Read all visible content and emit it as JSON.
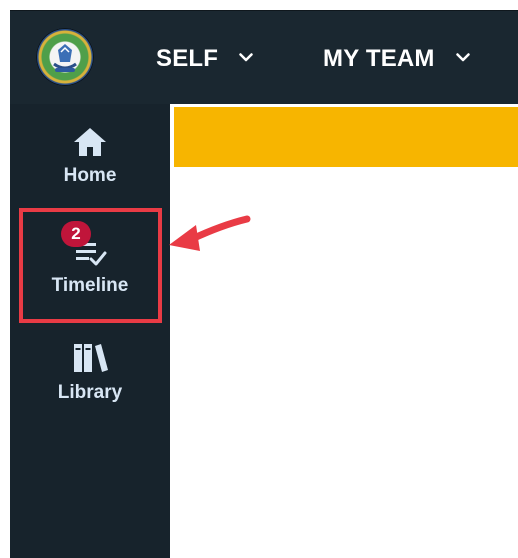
{
  "topnav": {
    "items": [
      {
        "label": "SELF"
      },
      {
        "label": "MY TEAM"
      }
    ]
  },
  "sidebar": {
    "items": [
      {
        "label": "Home",
        "icon": "home-icon"
      },
      {
        "label": "Timeline",
        "icon": "timeline-checklist-icon",
        "badge": "2"
      },
      {
        "label": "Library",
        "icon": "library-books-icon"
      }
    ]
  },
  "colors": {
    "sidebar_bg": "#17232c",
    "banner": "#f7b500",
    "highlight": "#e93b45",
    "badge": "#c0153a"
  }
}
